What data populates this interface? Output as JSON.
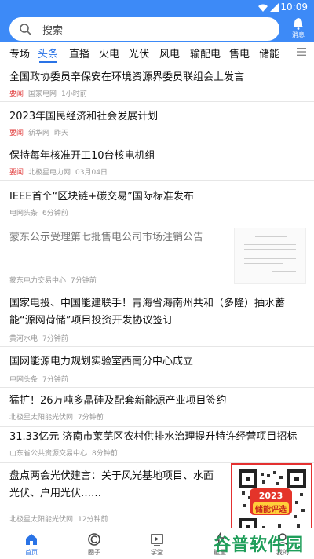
{
  "status_bar": {
    "time": "10:09"
  },
  "search": {
    "placeholder": "搜索"
  },
  "message": {
    "label": "消息"
  },
  "tabs": [
    {
      "label": "专场"
    },
    {
      "label": "头条"
    },
    {
      "label": "直播"
    },
    {
      "label": "火电"
    },
    {
      "label": "光伏"
    },
    {
      "label": "风电"
    },
    {
      "label": "输配电"
    },
    {
      "label": "售电"
    },
    {
      "label": "储能"
    }
  ],
  "active_tab": "头条",
  "feed": [
    {
      "title": "全国政协委员辛保安在环境资源界委员联组会上发言",
      "tag": "要闻",
      "source": "国家电网",
      "time": "1小时前"
    },
    {
      "title": "2023年国民经济和社会发展计划",
      "tag": "要闻",
      "source": "新华网",
      "time": "昨天"
    },
    {
      "title": "保持每年核准开工10台核电机组",
      "tag": "要闻",
      "source": "北极星电力网",
      "time": "03月04日"
    },
    {
      "title": "IEEE首个“区块链+碳交易”国际标准发布",
      "tag": "",
      "source": "电网头条",
      "time": "6分钟前"
    },
    {
      "title": "蒙东公示受理第七批售电公司市场注销公告",
      "tag": "",
      "source": "蒙东电力交易中心",
      "time": "7分钟前"
    },
    {
      "title": "国家电投、中国能建联手！青海省海南州共和（多隆）抽水蓄能“源网荷储”项目投资开发协议签订",
      "tag": "",
      "source": "黄河水电",
      "time": "7分钟前"
    },
    {
      "title": "国网能源电力规划实验室西南分中心成立",
      "tag": "",
      "source": "电网头条",
      "time": "7分钟前"
    },
    {
      "title": "猛扩！26万吨多晶硅及配套新能源产业项目签约",
      "tag": "",
      "source": "北极星太阳能光伏网",
      "time": "7分钟前"
    },
    {
      "title": "31.33亿元 济南市莱芜区农村供排水治理提升特许经营项目招标",
      "tag": "",
      "source": "山东省公共资源交易中心",
      "time": "8分钟前"
    },
    {
      "title": "盘点两会光伏建言：关于风光基地项目、水面光伏、户用光伏……",
      "tag": "",
      "source": "北极星太阳能光伏网",
      "time": "12分钟前"
    }
  ],
  "ad": {
    "year": "2023",
    "text": "储能评选"
  },
  "bottom_nav": [
    {
      "label": "首页",
      "icon": "home-icon"
    },
    {
      "label": "圈子",
      "icon": "circle-icon"
    },
    {
      "label": "学堂",
      "icon": "classroom-icon"
    },
    {
      "label": "能量",
      "icon": "energy-icon"
    },
    {
      "label": "我的",
      "icon": "profile-icon"
    }
  ],
  "watermark": "谷普软件园",
  "colors": {
    "accent": "#3d8af7",
    "active_tab": "#2a73e6",
    "tag": "#e24040",
    "watermark": "#1f9e5a"
  }
}
